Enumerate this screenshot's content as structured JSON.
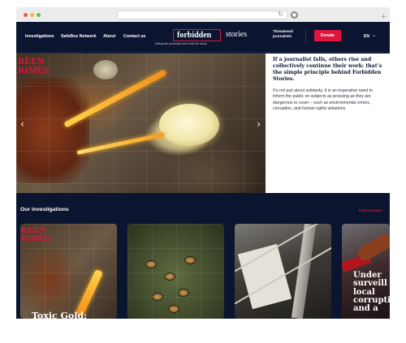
{
  "header": {
    "nav": [
      {
        "label": "Investigations"
      },
      {
        "label": "SafeBox Network"
      },
      {
        "label": "About"
      },
      {
        "label": "Contact us"
      }
    ],
    "logo_main": "forbidden",
    "logo_secondary": "stories",
    "tagline": "Killing the journalist won't kill the story",
    "threatened": "Threatened journalists",
    "donate_label": "Donate",
    "language": "EN"
  },
  "hero": {
    "image_tag": "REEN\nRIMES",
    "heading": "If a journalist falls, others rise and collectively continue their work: that’s the simple principle behind Forbidden Stories.",
    "body": "It’s not just about solidarity. It is an imperative need to inform the public on subjects as pressing as they are dangerous to cover – such as environmental crimes, corruption, and human rights violations."
  },
  "investigations": {
    "title": "Our investigations",
    "find_more": "Find out more",
    "cards": [
      {
        "tag": "REEN\nRIMES",
        "title": "Toxic Gold:"
      },
      {
        "tag": "",
        "title": ""
      },
      {
        "tag": "",
        "title": ""
      },
      {
        "tag": "",
        "title": "Under\nsurveill\nlocal\ncorrupti\nand a"
      }
    ]
  },
  "colors": {
    "navy": "#0c1530",
    "accent_red": "#e0143c",
    "white": "#ffffff"
  },
  "icons": {
    "prev": "chevron-left-icon",
    "next": "chevron-right-icon",
    "language_dropdown": "chevron-down-icon",
    "reload": "reload-icon"
  }
}
